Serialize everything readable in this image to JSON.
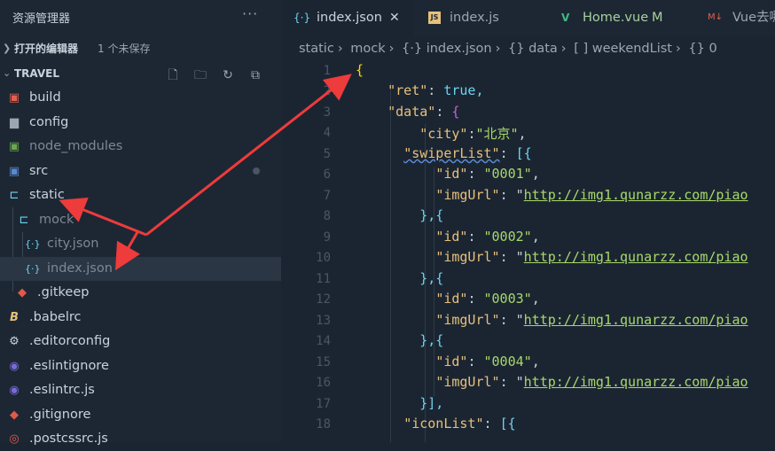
{
  "sidebar": {
    "title": "资源管理器",
    "more": "···",
    "open_editors": {
      "label": "打开的编辑器",
      "badge": "1 个未保存"
    },
    "project": {
      "label": "TRAVEL"
    },
    "actions": [
      "new-file-icon",
      "new-folder-icon",
      "refresh-icon",
      "collapse-all-icon"
    ],
    "tree": [
      {
        "name": "build"
      },
      {
        "name": "config"
      },
      {
        "name": "node_modules"
      },
      {
        "name": "src"
      },
      {
        "name": "static"
      },
      {
        "name": "mock"
      },
      {
        "name": "city.json"
      },
      {
        "name": "index.json"
      },
      {
        "name": ".gitkeep"
      },
      {
        "name": ".babelrc"
      },
      {
        "name": ".editorconfig"
      },
      {
        "name": ".eslintignore"
      },
      {
        "name": ".eslintrc.js"
      },
      {
        "name": ".gitignore"
      },
      {
        "name": ".postcssrc.js"
      }
    ]
  },
  "tabs": [
    {
      "icon": "{·}",
      "label": "index.json",
      "close": "✕"
    },
    {
      "icon": "JS",
      "label": "index.js"
    },
    {
      "icon": "V",
      "label": "Home.vue",
      "status": "M"
    },
    {
      "icon": "M↓",
      "label": "Vue去哪"
    }
  ],
  "breadcrumb": [
    "static",
    "mock",
    "{·} index.json",
    "{} data",
    "[ ] weekendList",
    "{} 0"
  ],
  "line_numbers": [
    "1",
    "2",
    "3",
    "4",
    "5",
    "6",
    "7",
    "8",
    "9",
    "10",
    "11",
    "12",
    "13",
    "14",
    "15",
    "16",
    "17",
    "18"
  ],
  "code": {
    "l1": "{",
    "ret_key": "\"ret\"",
    "ret_val": "true,",
    "data_key": "\"data\"",
    "data_open": "{",
    "city_key": "\"city\"",
    "city_val": "\"北京\"",
    "swiper_key": "\"swiperList\"",
    "swiper_open": "[{",
    "id1": "\"0001\"",
    "id2": "\"0002\"",
    "id3": "\"0003\"",
    "id4": "\"0004\"",
    "id_key": "\"id\"",
    "img_key": "\"imgUrl\"",
    "img_url": "http://img1.qunarzz.com/piao",
    "obj_sep": "},{",
    "arr_close": "}],",
    "icon_key": "\"iconList\"",
    "icon_open": "[{"
  }
}
